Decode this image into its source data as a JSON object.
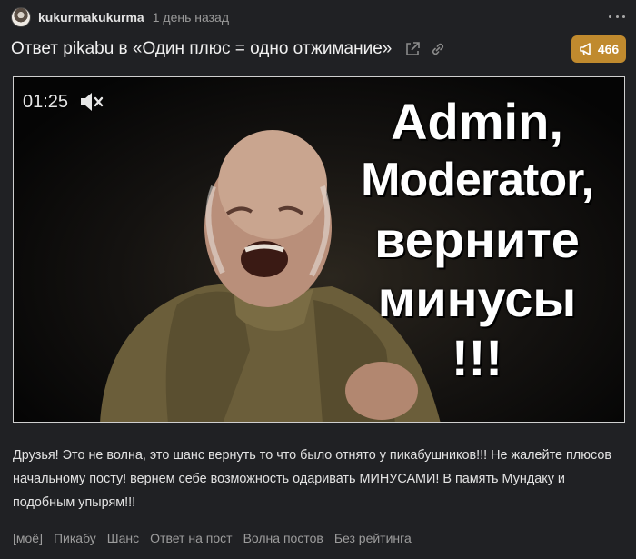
{
  "author": {
    "name": "kukurmakukurma",
    "time": "1 день назад"
  },
  "post": {
    "title": "Ответ pikabu в «Один плюс = одно отжимание»",
    "rating": "466",
    "body": "Друзья! Это не волна, это шанс вернуть то что было отнято у пикабушников!!! Не жалейте плюсов начальному посту! вернем себе возможность одаривать МИНУСАМИ! В память Мундаку и подобным упырям!!!"
  },
  "video": {
    "time": "01:25",
    "overlay_lines": [
      "Admin,",
      "Moderator,",
      "верните",
      "минусы",
      "!!!"
    ]
  },
  "tags": [
    "[моё]",
    "Пикабу",
    "Шанс",
    "Ответ на пост",
    "Волна постов",
    "Без рейтинга"
  ],
  "colors": {
    "background": "#202124",
    "rating_badge": "#c08a2e",
    "tag_text": "#9c9c9c"
  },
  "icons": [
    "avatar",
    "more-dots-icon",
    "external-link-icon",
    "link-icon",
    "megaphone-icon",
    "mute-icon"
  ]
}
